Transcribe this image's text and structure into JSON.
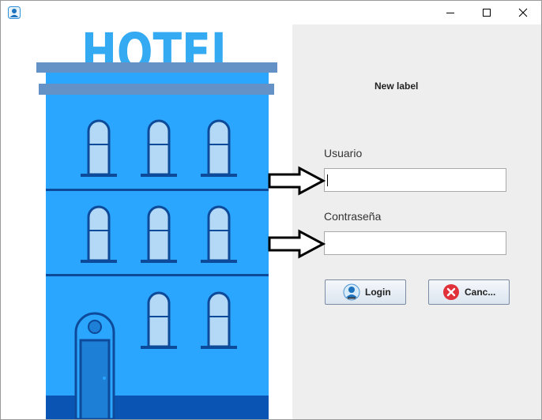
{
  "window": {
    "icon": "user-app-icon",
    "controls": [
      "minimize-icon",
      "maximize-icon",
      "close-icon"
    ]
  },
  "illustration": {
    "sign_text": "HOTEL",
    "colors": {
      "building": "#2aa6ff",
      "sign": "#33aaf2",
      "trim": "#0d4a99",
      "window_glass": "#b3d9f7",
      "roof": "#6592c6"
    }
  },
  "login_form": {
    "title_label": "New label",
    "username_label": "Usuario",
    "username_value": "",
    "password_label": "Contraseña",
    "password_value": "",
    "login_button": {
      "label": "Login",
      "icon": "user-icon"
    },
    "cancel_button": {
      "label": "Canc...",
      "icon": "cancel-x-icon"
    },
    "accent_cancel": "#e0303a"
  }
}
